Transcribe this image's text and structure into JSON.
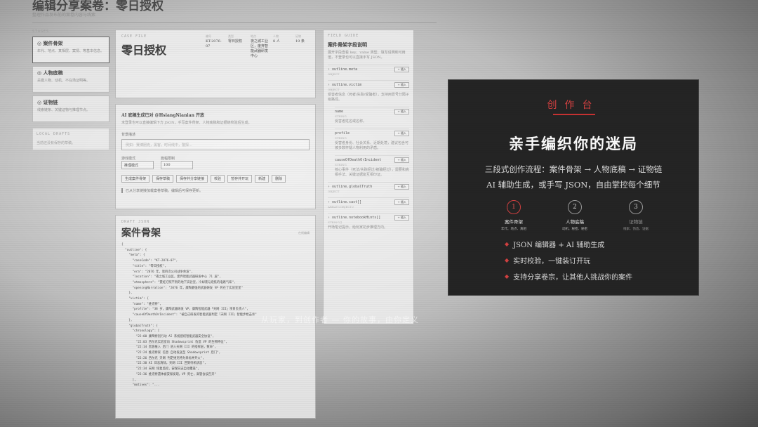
{
  "editor": {
    "title": "编辑分享案卷：零日授权",
    "subtitle": "整理作品发布前的案卷内容与线索",
    "stages_label": "STAGES",
    "stages": [
      {
        "name": "案件骨架",
        "desc": "年代、地点、真相层、案情、等基本信息。"
      },
      {
        "name": "人物底稿",
        "desc": "关键人物、动机、不在场证明等。"
      },
      {
        "name": "证物链",
        "desc": "线索链条、关键证物与推理节点。"
      }
    ],
    "local_label": "LOCAL DRAFTS",
    "local_desc": "当前还没有保存的草稿。",
    "case_kicker": "CASE FILE",
    "case_title": "零日授权",
    "meta": [
      {
        "label": "编号",
        "value": "KT-2076-07"
      },
      {
        "label": "类型",
        "value": "零日授权"
      },
      {
        "label": "地点",
        "value": "夜之城工业区，废弃智能武器研发中心"
      },
      {
        "label": "人物",
        "value": "8 人"
      },
      {
        "label": "证物",
        "value": "19 条"
      }
    ],
    "ai": {
      "title": "AI 底稿生成已对 @HsiangNianian 开放",
      "desc": "未登录也可以直接编辑下方 JSON，手写案件骨架、人物底稿和证据链校验后生成。",
      "prompt_label": "背景描述",
      "prompt_placeholder": "例如：赛博朋克，黑客，时间线中，警探...",
      "mode_label": "游戏模式",
      "mode_value": "推理模式",
      "length_label": "篇幅限制",
      "length_value": "100",
      "buttons": [
        "生成案件骨架",
        "保存草稿",
        "保存并分享链接",
        "校验",
        "暂存并开玩",
        "新建",
        "删除"
      ],
      "status": "已从分享链接加载案卷草稿，编辑后可保存更新。"
    },
    "json": {
      "kicker": "DRAFT JSON",
      "title": "案件骨架",
      "right_label": "在线编辑",
      "code": "{\n  \"outline\": {\n    \"meta\": {\n      \"caseCode\": \"KT-2076-07\",\n      \"title\": \"零日授权\",\n      \"era\": \"2076 年，第四次公司战争余波\",\n      \"location\": \"夜之城工业区，废弃智能武器研发中心 71 层\",\n      \"atmosphere\": \"霓虹灯照不到的地下实验室，冷却液与烧焦的电路气味\",\n      \"openingNarration\": \"2076 年，康陶最强的武器研发 VP 死在了实验室里\"\n    },\n    \"victim\": {\n      \"name\": \"维克特\",\n      \"profile\": \"38 岁，康陶武器研发 VP，康陶智能武器「天网 III」项目负责人\",\n      \"causeOfDeathOrIncident\": \"被自己研发的智能武器判定『天网 III』智能步枪击杀\"\n    },\n    \"globalTruth\": {\n      \"chronology\": [\n        \"22:00 康陶特别行动 AI 系统授权智能武器安全协议\",\n        \"22:03 西尔克实验室向 Shadowsprint 伪造 VP 的生物特征\",\n        \"22:14 黑客植入 后门 进入天网 III 的指挥层，致命\",\n        \"22:24 维克特家 信息 自动发送至 Shadowsprint 后门\",\n        \"22:26 西尔克 天网 判定维克特为目标并开火\",\n        \"22:30 AI 日志清除，天网 III 回到待机状态\",\n        \"22:34 天网 恢复监控，安保日志自动覆盖\",\n        \"22:36 维克特遗体被安保发现，VP 死亡，高管会议召开\"\n      ],\n      \"motives\": \"..."
    },
    "fields": {
      "kicker": "FIELD GUIDE",
      "title": "案件骨架字段说明",
      "desc": "展开字段查看 key、value 类型、填写说明和可用值，不登录也可以直接手写 JSON。",
      "items": [
        {
          "name": "outline.meta",
          "type": "OBJECT",
          "insert": "+ 插入"
        },
        {
          "name": "outline.victim",
          "type": "OBJECT",
          "insert": "+ 插入",
          "desc": "受害者信息（死者/失踪/受骗者），支持用冒号分隔子级路径。"
        },
        {
          "name": "name",
          "type": "STRING",
          "insert": "+ 插入",
          "desc": "受害者姓名或名称。",
          "sub": true
        },
        {
          "name": "profile",
          "type": "STRING",
          "insert": "+ 插入",
          "desc": "受害者身份、社会关系、近期处境，建议包含可被多数怀疑人物利用的矛盾。",
          "sub": true
        },
        {
          "name": "causeOfDeathOrIncident",
          "type": "STRING",
          "insert": "+ 插入",
          "desc": "核心事件（死法/失踪经过/被骗经过），需要和真相手法、关键证据能互相印证。",
          "sub": true
        },
        {
          "name": "outline.globalTruth",
          "type": "OBJECT",
          "insert": "+ 插入"
        },
        {
          "name": "outline.cast[]",
          "type": "ARRAY<OBJECT>",
          "insert": "+ 插入"
        },
        {
          "name": "outline.notebookHints[]",
          "type": "STRING[]",
          "insert": "+ 插入",
          "desc": "开场笔记提示，给玩家初步推理方向。"
        }
      ]
    }
  },
  "overlay": {
    "kicker": "创作台",
    "headline": "亲手编织你的迷局",
    "line1": "三段式创作流程：案件骨架 → 人物底稿 → 证物链",
    "line2": "AI 辅助生成，或手写 JSON，自由掌控每个细节",
    "steps": [
      {
        "num": "1",
        "name": "案件骨架",
        "sub": "年代、地点、真相",
        "active": true
      },
      {
        "num": "2",
        "name": "人物底稿",
        "sub": "动机、秘密、秘密",
        "active": false
      },
      {
        "num": "3",
        "name": "证物链",
        "sub": "线索、伪造、证据",
        "active": false
      }
    ],
    "bullets": [
      "JSON 编辑器 + AI 辅助生成",
      "实时校验，一键装订开玩",
      "支持分享卷宗，让其他人挑战你的案件"
    ],
    "accent": "#d14040"
  },
  "caption": "从玩家，到创作者 — 你的故事，由你定义"
}
